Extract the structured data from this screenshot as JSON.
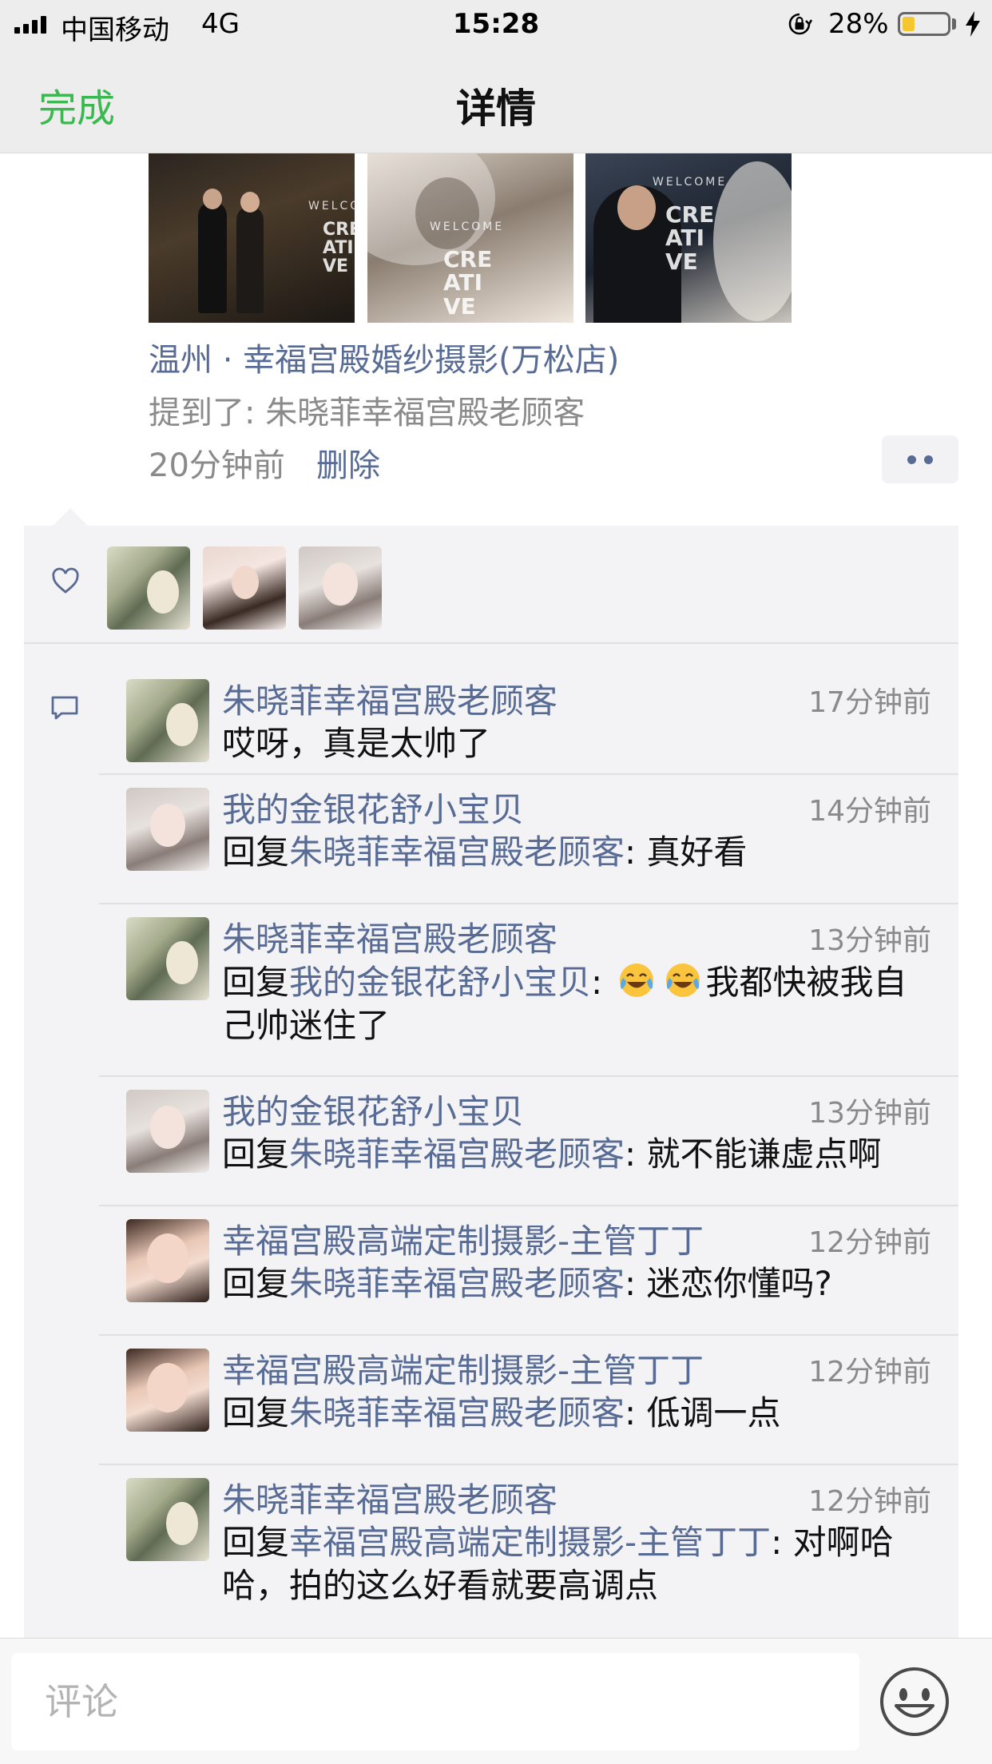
{
  "status_bar": {
    "carrier": "中国移动",
    "network": "4G",
    "time": "15:28",
    "battery_percent": "28%",
    "battery_level": 0.28,
    "icons": [
      "signal-icon",
      "orientation-lock-icon",
      "battery-icon",
      "charging-bolt-icon"
    ]
  },
  "nav": {
    "done_label": "完成",
    "title": "详情"
  },
  "post": {
    "photos": [
      {
        "name": "photo-1",
        "text_word": "CRE ATI VE",
        "text_small": "WELCOME"
      },
      {
        "name": "photo-2",
        "text_word": "CRE ATI VE",
        "text_small": "WELCOME"
      },
      {
        "name": "photo-3",
        "text_word": "CRE ATI VE",
        "text_small": "WELCOME"
      }
    ],
    "location": "温州 · 幸福宫殿婚纱摄影(万松店)",
    "mention": "提到了: 朱晓菲幸福宫殿老顾客",
    "time_ago": "20分钟前",
    "delete_label": "删除"
  },
  "likes": {
    "icon": "heart-icon",
    "avatars": [
      "朱晓菲幸福宫殿老顾客",
      "我的金银花舒小宝贝",
      "幸福宫殿高端定制摄影-主管丁丁"
    ]
  },
  "comments": [
    {
      "name": "朱晓菲幸福宫殿老顾客",
      "time": "17分钟前",
      "reply_prefix": "",
      "reply_to": "",
      "text": "哎呀，真是太帅了"
    },
    {
      "name": "我的金银花舒小宝贝",
      "time": "14分钟前",
      "reply_prefix": "回复",
      "reply_to": "朱晓菲幸福宫殿老顾客",
      "text": ": 真好看"
    },
    {
      "name": "朱晓菲幸福宫殿老顾客",
      "time": "13分钟前",
      "reply_prefix": "回复",
      "reply_to": "我的金银花舒小宝贝",
      "text": "我都快被我自己帅迷住了",
      "emoji": "laughing-tears-emoji"
    },
    {
      "name": "我的金银花舒小宝贝",
      "time": "13分钟前",
      "reply_prefix": "回复",
      "reply_to": "朱晓菲幸福宫殿老顾客",
      "text": ": 就不能谦虚点啊"
    },
    {
      "name": "幸福宫殿高端定制摄影-主管丁丁",
      "time": "12分钟前",
      "reply_prefix": "回复",
      "reply_to": "朱晓菲幸福宫殿老顾客",
      "text": ": 迷恋你懂吗?"
    },
    {
      "name": "幸福宫殿高端定制摄影-主管丁丁",
      "time": "12分钟前",
      "reply_prefix": "回复",
      "reply_to": "朱晓菲幸福宫殿老顾客",
      "text": ": 低调一点"
    },
    {
      "name": "朱晓菲幸福宫殿老顾客",
      "time": "12分钟前",
      "reply_prefix": "回复",
      "reply_to": "幸福宫殿高端定制摄影-主管丁丁",
      "text": ": 对啊哈哈，拍的这么好看就要高调点"
    }
  ],
  "comment_bar": {
    "placeholder": "评论",
    "emoji_button": "smiley-icon"
  },
  "colors": {
    "link_blue": "#576b95",
    "accent_green": "#3cb850",
    "panel_bg": "#f3f3f5",
    "battery_yellow": "#f4c630"
  }
}
